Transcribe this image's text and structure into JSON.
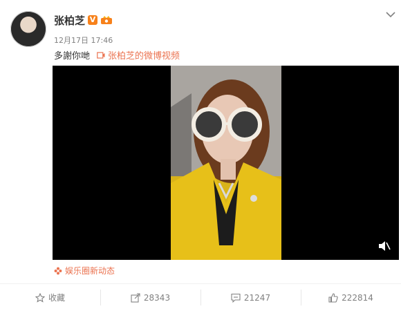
{
  "post": {
    "author": "张柏芝",
    "time": "12月17日 17:46",
    "text": "多謝你哋",
    "video_link": "张柏芝的微博视频",
    "tag": "娱乐圈新动态"
  },
  "actions": {
    "favorite": "收藏",
    "share": "28343",
    "comment": "21247",
    "like": "222814"
  },
  "colors": {
    "accent": "#eb7350",
    "verified": "#f7811a",
    "video_bg": "#000000"
  }
}
